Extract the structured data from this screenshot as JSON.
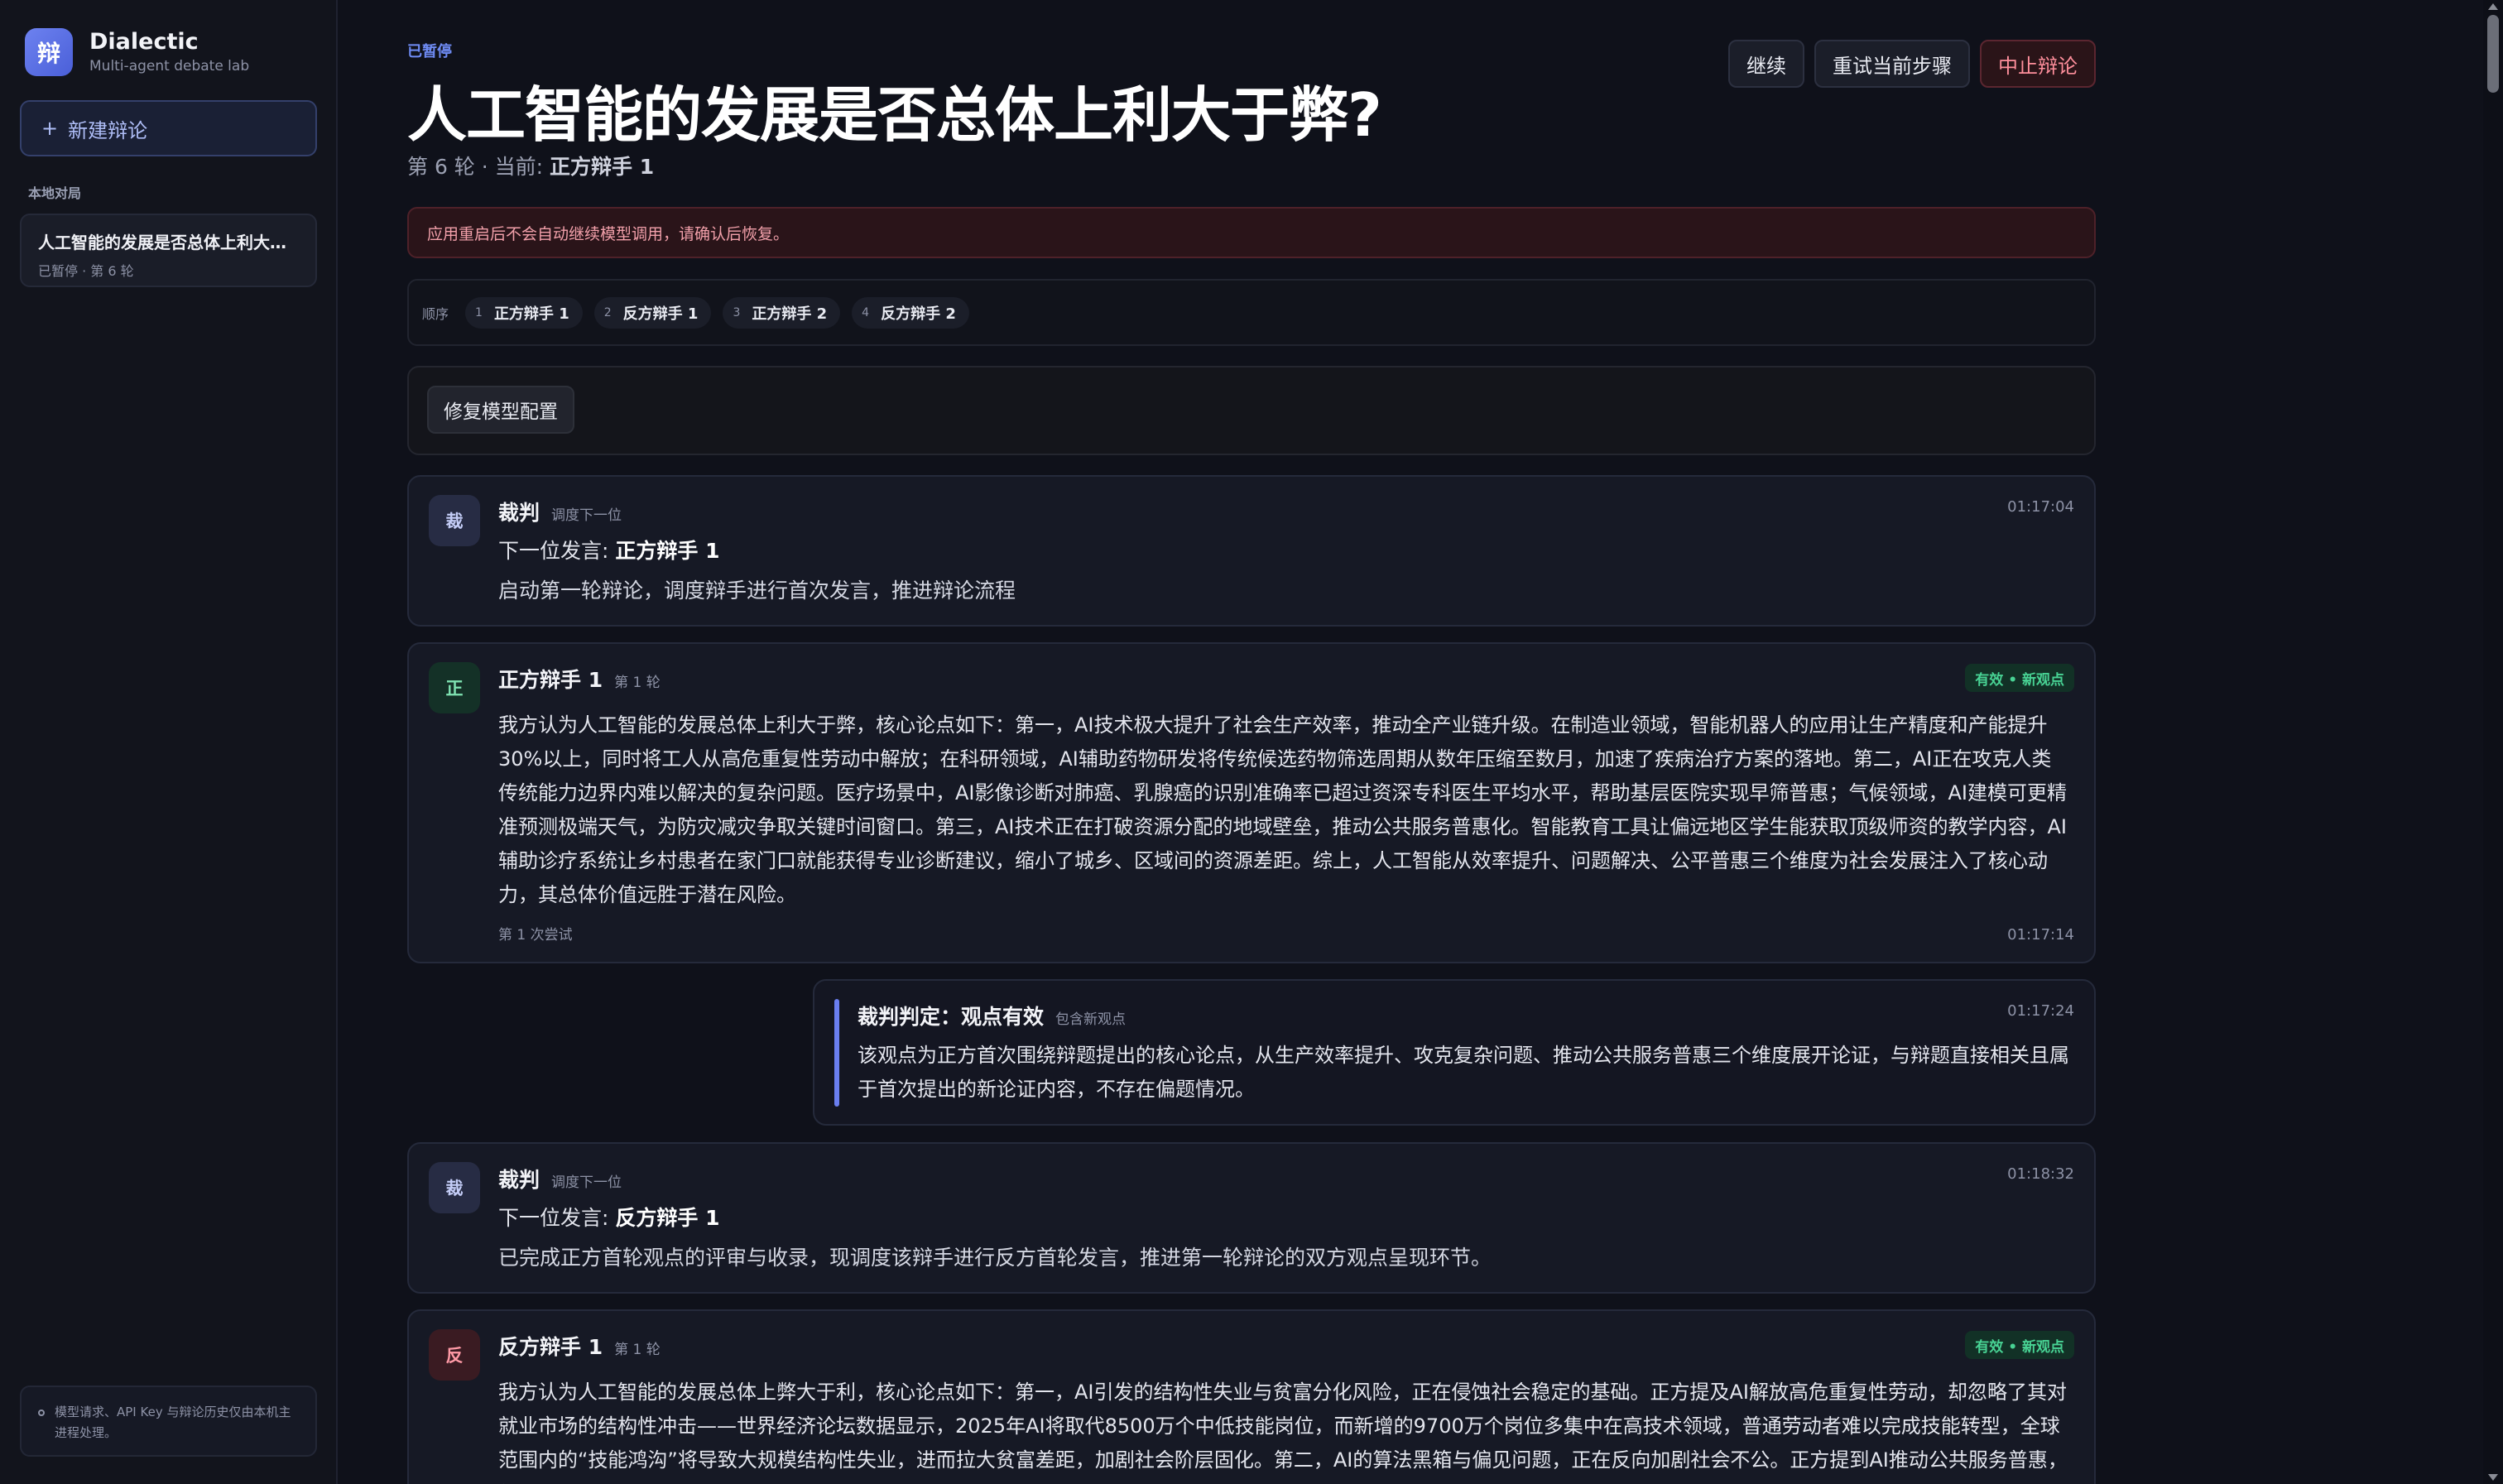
{
  "sidebar": {
    "brand": {
      "logo_char": "辩",
      "name": "Dialectic",
      "subtitle": "Multi-agent debate lab"
    },
    "new_debate_label": "新建辩论",
    "section_label": "本地对局",
    "sessions": [
      {
        "title": "人工智能的发展是否总体上利大于...",
        "meta": "已暂停 · 第 6 轮"
      }
    ],
    "note": "模型请求、API Key 与辩论历史仅由本机主进程处理。"
  },
  "header": {
    "status": "已暂停",
    "title": "人工智能的发展是否总体上利大于弊?",
    "round_prefix": "第 6 轮 · 当前:",
    "current_speaker": "正方辩手 1",
    "actions": {
      "continue": "继续",
      "retry": "重试当前步骤",
      "abort": "中止辩论"
    }
  },
  "warning": "应用重启后不会自动继续模型调用，请确认后恢复。",
  "order": {
    "label": "顺序",
    "items": [
      {
        "num": "1",
        "name": "正方辩手 1"
      },
      {
        "num": "2",
        "name": "反方辩手 1"
      },
      {
        "num": "3",
        "name": "正方辩手 2"
      },
      {
        "num": "4",
        "name": "反方辩手 2"
      }
    ]
  },
  "fix_button": "修复模型配置",
  "messages": [
    {
      "avatar": "裁",
      "speaker": "裁判",
      "role": "调度下一位",
      "time": "01:17:04",
      "next_prefix": "下一位发言:",
      "next_name": "正方辩手 1",
      "reason": "启动第一轮辩论，调度辩手进行首次发言，推进辩论流程"
    },
    {
      "avatar": "正",
      "speaker": "正方辩手 1",
      "role": "第 1 轮",
      "badge": "有效 • 新观点",
      "text": "我方认为人工智能的发展总体上利大于弊，核心论点如下：第一，AI技术极大提升了社会生产效率，推动全产业链升级。在制造业领域，智能机器人的应用让生产精度和产能提升30%以上，同时将工人从高危重复性劳动中解放；在科研领域，AI辅助药物研发将传统候选药物筛选周期从数年压缩至数月，加速了疾病治疗方案的落地。第二，AI正在攻克人类传统能力边界内难以解决的复杂问题。医疗场景中，AI影像诊断对肺癌、乳腺癌的识别准确率已超过资深专科医生平均水平，帮助基层医院实现早筛普惠；气候领域，AI建模可更精准预测极端天气，为防灾减灾争取关键时间窗口。第三，AI技术正在打破资源分配的地域壁垒，推动公共服务普惠化。智能教育工具让偏远地区学生能获取顶级师资的教学内容，AI辅助诊疗系统让乡村患者在家门口就能获得专业诊断建议，缩小了城乡、区域间的资源差距。综上，人工智能从效率提升、问题解决、公平普惠三个维度为社会发展注入了核心动力，其总体价值远胜于潜在风险。",
      "attempt": "第 1 次尝试",
      "time": "01:17:14"
    },
    {
      "avatar": "裁",
      "speaker": "裁判",
      "role": "调度下一位",
      "time": "01:18:32",
      "next_prefix": "下一位发言:",
      "next_name": "反方辩手 1",
      "reason": "已完成正方首轮观点的评审与收录，现调度该辩手进行反方首轮发言，推进第一轮辩论的双方观点呈现环节。"
    },
    {
      "avatar": "反",
      "speaker": "反方辩手 1",
      "role": "第 1 轮",
      "badge": "有效 • 新观点",
      "text": "我方认为人工智能的发展总体上弊大于利，核心论点如下：第一，AI引发的结构性失业与贫富分化风险，正在侵蚀社会稳定的基础。正方提及AI解放高危重复性劳动，却忽略了其对就业市场的结构性冲击——世界经济论坛数据显示，2025年AI将取代8500万个中低技能岗位，而新增的9700万个岗位多集中在高技术领域，普通劳动者难以完成技能转型，全球范围内的“技能鸿沟”将导致大规模结构性失业，进而拉大贫富差距，加剧社会阶层固化。第二，AI的算法黑箱与偏见问题，正在反向加剧社会不公。正方提到AI推动公共服务普惠，但"
    }
  ],
  "verdict": {
    "title": "裁判判定：观点有效",
    "sub": "包含新观点",
    "time": "01:17:24",
    "text": "该观点为正方首次围绕辩题提出的核心论点，从生产效率提升、攻克复杂问题、推动公共服务普惠三个维度展开论证，与辩题直接相关且属于首次提出的新论证内容，不存在偏题情况。"
  },
  "colors": {
    "accent": "#6f8cf5",
    "danger": "#ff8f9c",
    "valid": "#48d394"
  }
}
